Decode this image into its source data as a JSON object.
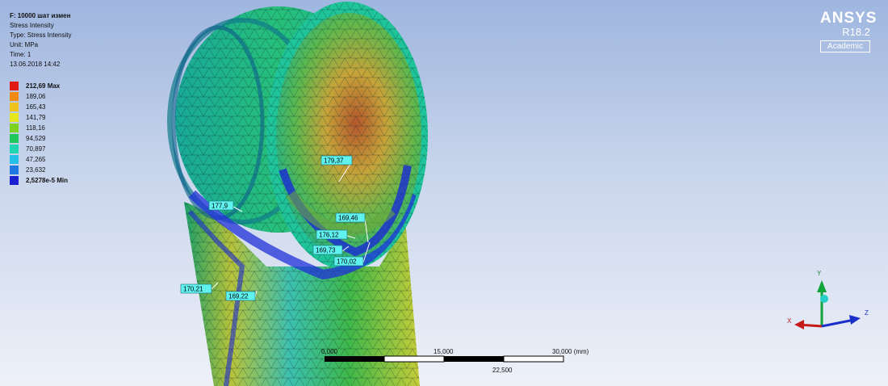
{
  "result_info": {
    "title": "F: 10000 шат измен",
    "type_label": "Stress Intensity",
    "type": "Type: Stress Intensity",
    "unit": "Unit: MPa",
    "time": "Time: 1",
    "date": "13.06.2018 14:42"
  },
  "legend": [
    {
      "label": "212,69 Max",
      "color": "#e11a14",
      "bold": true
    },
    {
      "label": "189,06",
      "color": "#f08a12",
      "bold": false
    },
    {
      "label": "165,43",
      "color": "#eec41c",
      "bold": false
    },
    {
      "label": "141,79",
      "color": "#e6e61e",
      "bold": false
    },
    {
      "label": "118,16",
      "color": "#7ed321",
      "bold": false
    },
    {
      "label": "94,529",
      "color": "#21c75b",
      "bold": false
    },
    {
      "label": "70,897",
      "color": "#1fd6b0",
      "bold": false
    },
    {
      "label": "47,265",
      "color": "#25c0e8",
      "bold": false
    },
    {
      "label": "23,632",
      "color": "#1f78e0",
      "bold": false
    },
    {
      "label": "2,5278e-5 Min",
      "color": "#1a1fd1",
      "bold": true
    }
  ],
  "brand": {
    "name": "ANSYS",
    "version": "R18.2",
    "edition": "Academic"
  },
  "probes": [
    {
      "value": "179,37"
    },
    {
      "value": "177,9"
    },
    {
      "value": "169,46"
    },
    {
      "value": "176,12"
    },
    {
      "value": "169,73"
    },
    {
      "value": "170,02"
    },
    {
      "value": "170,21"
    },
    {
      "value": "169,22"
    }
  ],
  "scale_bar": {
    "start": "0,000",
    "mid": "15,000",
    "end": "30,000 (mm)",
    "sub": "22,500"
  },
  "triad": {
    "x": "X",
    "y": "Y",
    "z": "Z"
  }
}
